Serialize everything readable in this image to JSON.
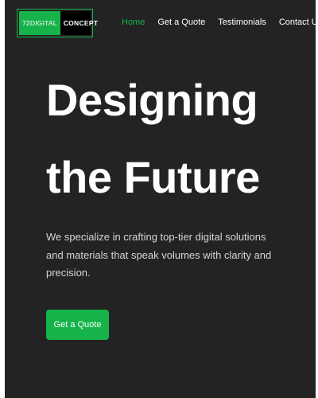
{
  "brand": {
    "part1": "72DIGITAL",
    "part2": "CONCEPT"
  },
  "nav": {
    "items": [
      {
        "label": "Home",
        "active": true
      },
      {
        "label": "Get a Quote",
        "active": false
      },
      {
        "label": "Testimonials",
        "active": false
      },
      {
        "label": "Contact Us",
        "active": false
      }
    ]
  },
  "hero": {
    "line1": "Designing",
    "line2_prefix": "the ",
    "line2_highlight": "Future",
    "description": "We specialize in crafting top-tier digital solutions and materials that speak volumes with clarity and precision.",
    "cta_label": "Get a Quote"
  },
  "colors": {
    "accent": "#16b34a",
    "background": "#232323",
    "text": "#ffffff"
  }
}
